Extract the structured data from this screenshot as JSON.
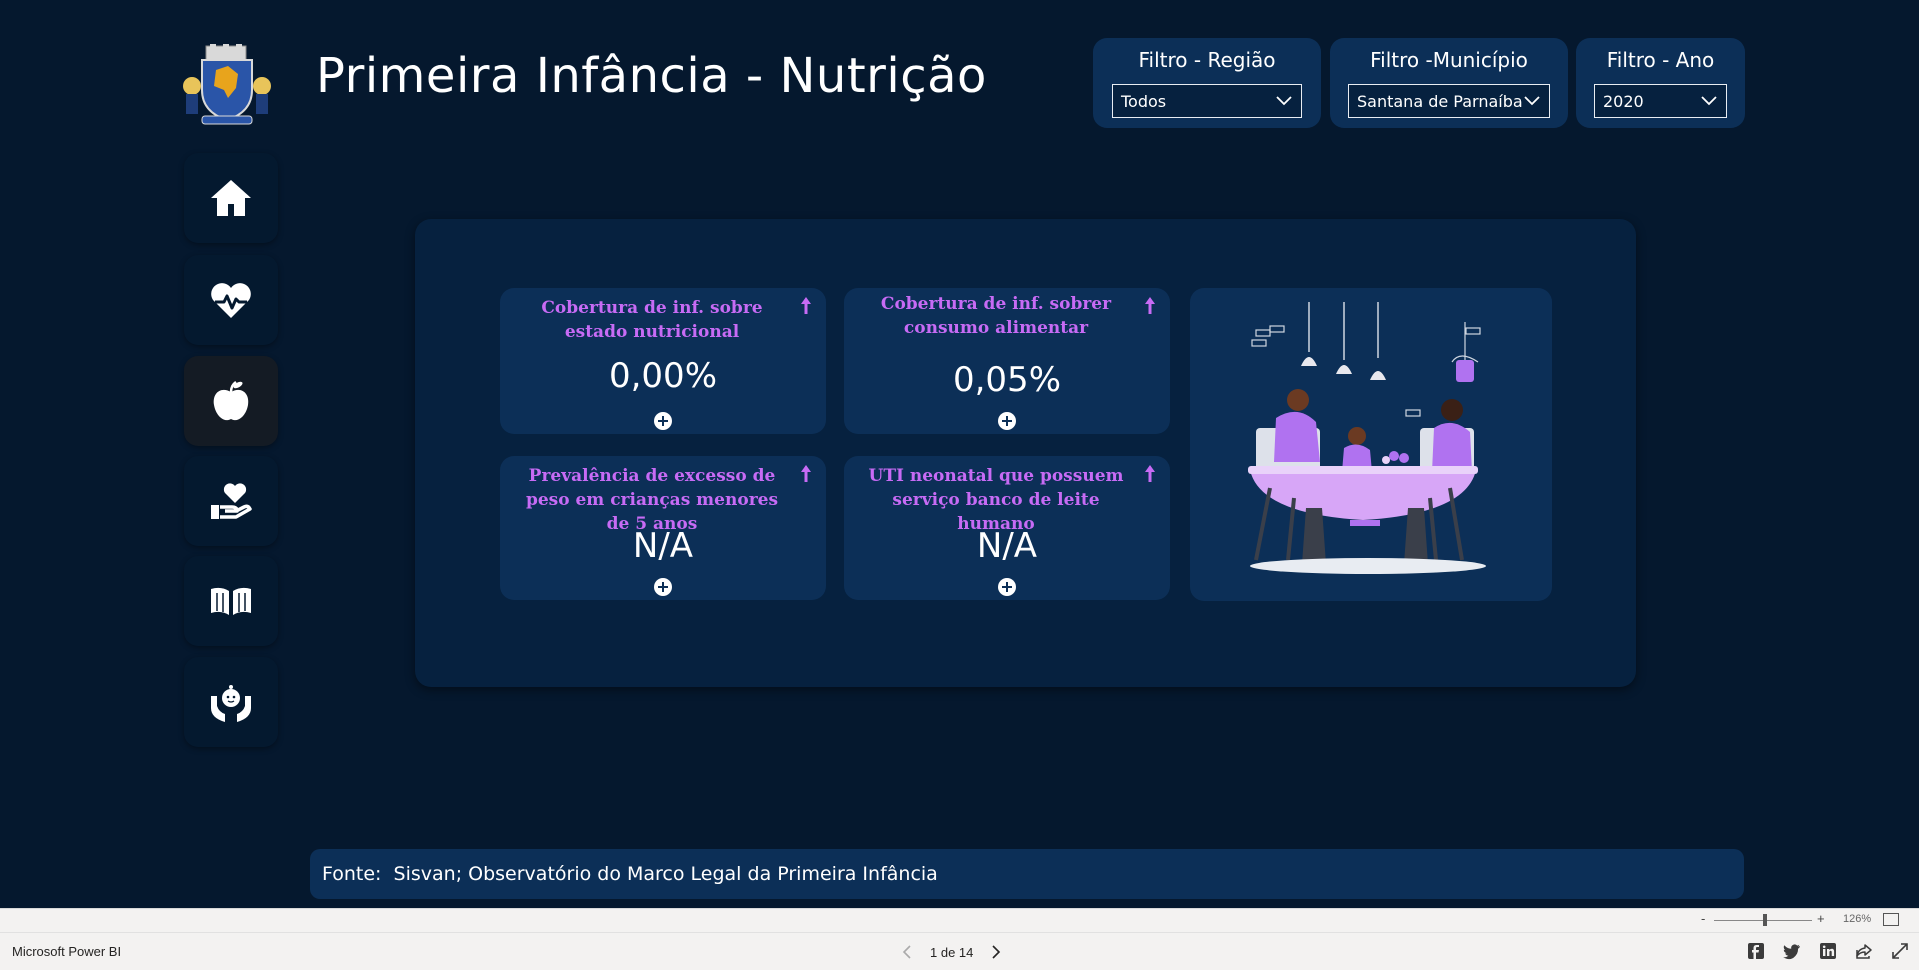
{
  "page": {
    "title": "Primeira Infância - Nutrição"
  },
  "filters": {
    "regiao": {
      "label": "Filtro - Região",
      "value": "Todos"
    },
    "municipio": {
      "label": "Filtro -Município",
      "value": "Santana de Parnaíba"
    },
    "ano": {
      "label": "Filtro - Ano",
      "value": "2020"
    }
  },
  "sidebar": {
    "items": [
      {
        "icon": "home-icon"
      },
      {
        "icon": "heart-pulse-icon"
      },
      {
        "icon": "apple-icon",
        "active": true
      },
      {
        "icon": "hand-heart-icon"
      },
      {
        "icon": "book-icon"
      },
      {
        "icon": "child-care-icon"
      }
    ]
  },
  "kpis": [
    {
      "title": "Cobertura de inf. sobre estado nutricional",
      "value": "0,00%"
    },
    {
      "title": "Cobertura de inf. sobrer consumo alimentar",
      "value": "0,05%"
    },
    {
      "title": "Prevalência de excesso de peso em crianças menores de 5 anos",
      "value": "N/A"
    },
    {
      "title": "UTI neonatal que possuem serviço banco de leite humano",
      "value": "N/A"
    }
  ],
  "source": {
    "text": "Fonte:  Sisvan; Observatório do Marco Legal da Primeira Infância"
  },
  "zoom": {
    "minus": "-",
    "plus": "+",
    "level": "126%",
    "slider_fraction": 0.52
  },
  "status": {
    "brand": "Microsoft Power BI",
    "page_indicator": "1 de 14"
  },
  "colors": {
    "background": "#05182e",
    "panel": "#06213f",
    "card": "#0c2f57",
    "kpi_title": "#c76bf5",
    "accent_purple": "#b072f0"
  }
}
